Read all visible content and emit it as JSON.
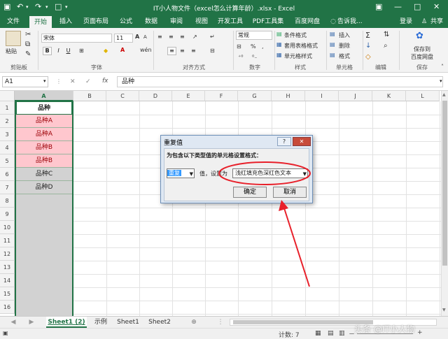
{
  "titlebar": {
    "title": "IT小人物文件（excel怎么计算年龄）.xlsx - Excel",
    "minimize": "—",
    "restore": "□",
    "close": "✕",
    "ribbon_opts": "▣"
  },
  "tabs": [
    "文件",
    "开始",
    "插入",
    "页面布局",
    "公式",
    "数据",
    "审阅",
    "视图",
    "开发工具",
    "PDF工具集",
    "百度网盘"
  ],
  "tellme": "告诉我...",
  "login": "登录",
  "share": "共享",
  "ribbon": {
    "paste": "粘贴",
    "font_name": "宋体",
    "font_size": "11",
    "bold": "B",
    "italic": "I",
    "underline": "U",
    "font_grow": "A",
    "font_shrink": "A",
    "wen": "wén",
    "number_format": "常规",
    "percent": "%",
    "comma": ",",
    "cond_format": "条件格式",
    "table_format": "套用表格格式",
    "cell_styles": "单元格样式",
    "insert": "插入",
    "delete": "删除",
    "format": "格式",
    "save_baidu_1": "保存到",
    "save_baidu_2": "百度网盘",
    "groups": [
      "剪贴板",
      "字体",
      "对齐方式",
      "数字",
      "样式",
      "单元格",
      "编辑",
      "保存"
    ]
  },
  "formula_bar": {
    "cell_ref": "A1",
    "fx": "fx",
    "cancel": "✕",
    "enter": "✓",
    "value": "品种"
  },
  "columns": [
    "A",
    "B",
    "C",
    "D",
    "E",
    "F",
    "G",
    "H",
    "I",
    "J",
    "K",
    "L"
  ],
  "rows": [
    "1",
    "2",
    "3",
    "4",
    "5",
    "6",
    "7",
    "8",
    "9",
    "10",
    "11",
    "12",
    "13",
    "14",
    "15",
    "16"
  ],
  "cells_A": [
    "品种",
    "品种A",
    "品种A",
    "品种B",
    "品种B",
    "品种C",
    "品种D"
  ],
  "dialog": {
    "title": "重复值",
    "help": "?",
    "close": "✕",
    "prompt": "为包含以下类型值的单元格设置格式：",
    "type_value": "重复",
    "middle_text": "值，设置为",
    "format_value": "浅红填充色深红色文本",
    "ok": "确定",
    "cancel": "取消"
  },
  "sheets": [
    "Sheet1 (2)",
    "示例",
    "Sheet1",
    "Sheet2"
  ],
  "add_sheet": "⊕",
  "status": {
    "count": "计数: 7",
    "zoom_minus": "－",
    "zoom_plus": "+",
    "watermark": "头条 @IT小人物"
  },
  "colors": {
    "excel_green": "#217346",
    "dup_fill": "#ffc7ce",
    "dup_text": "#9c0006",
    "annotation_red": "#e8202a"
  }
}
